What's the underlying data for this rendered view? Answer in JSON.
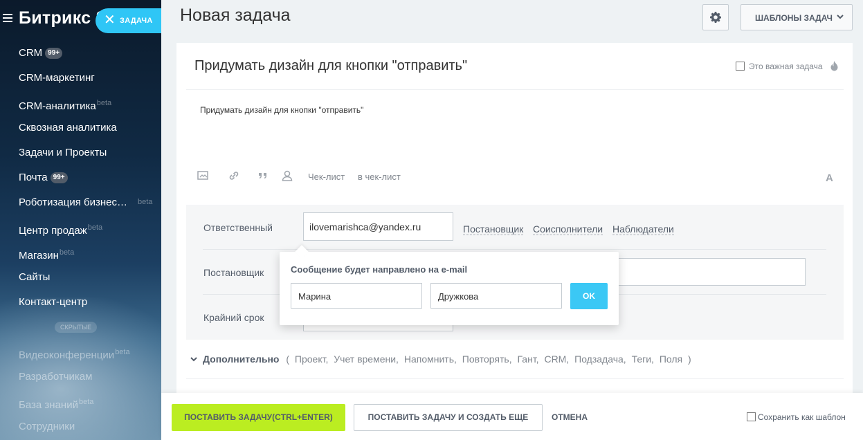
{
  "sidebar": {
    "brand": "Битрикс 24",
    "task_button_label": "ЗАДАЧА",
    "items": [
      {
        "label": "CRM",
        "badge": "99+"
      },
      {
        "label": "CRM-маркетинг"
      },
      {
        "label": "CRM-аналитика",
        "sup": "beta"
      },
      {
        "label": "Сквозная аналитика"
      },
      {
        "label": "Задачи и Проекты"
      },
      {
        "label": "Почта",
        "badge": "99+"
      },
      {
        "label": "Роботизация бизнес…",
        "sup": "beta"
      },
      {
        "label": "Центр продаж",
        "sup": "beta"
      },
      {
        "label": "Магазин",
        "sup": "beta"
      },
      {
        "label": "Сайты"
      },
      {
        "label": "Контакт-центр"
      }
    ],
    "hidden_separator": "СКРЫТЫЕ",
    "hidden_items": [
      {
        "label": "Видеоконференции",
        "sup": "beta"
      },
      {
        "label": "Разработчикам"
      },
      {
        "label": "База знаний",
        "sup": "beta"
      },
      {
        "label": "Сотрудники"
      }
    ]
  },
  "header": {
    "title": "Новая задача",
    "templates_label": "ШАБЛОНЫ ЗАДАЧ"
  },
  "task": {
    "title": "Придумать дизайн для кнопки \"отправить\"",
    "important_label": "Это важная задача",
    "description": "Придумать дизайн для кнопки \"отправить\"",
    "toolbar": {
      "checklist": "Чек-лист",
      "to_checklist": "в чек-лист",
      "font_icon": "A"
    }
  },
  "fields": {
    "responsible_label": "Ответственный",
    "responsible_value": "ilovemarishca@yandex.ru",
    "links": [
      "Постановщик",
      "Соисполнители",
      "Наблюдатели"
    ],
    "setter_label": "Постановщик",
    "deadline_label": "Крайний срок"
  },
  "popup": {
    "message": "Сообщение будет направлено на e-mail",
    "first_name": "Марина",
    "last_name": "Дружкова",
    "ok_label": "OK"
  },
  "extra": {
    "label": "Дополнительно",
    "open_paren": "(",
    "items": [
      "Проект,",
      "Учет времени,",
      "Напомнить,",
      "Повторять,",
      "Гант,",
      "CRM,",
      "Подзадача,",
      "Теги,",
      "Поля"
    ],
    "close_paren": ")"
  },
  "footer": {
    "submit_label": "ПОСТАВИТЬ ЗАДАЧУ(CTRL+ENTER)",
    "submit_more_label": "ПОСТАВИТЬ ЗАДАЧУ И СОЗДАТЬ ЕЩЕ",
    "cancel_label": "ОТМЕНА",
    "save_template_label": "Сохранить как шаблон"
  },
  "colors": {
    "accent": "#2fc6f6",
    "submit": "#bbed21",
    "ok": "#3bc8f5"
  }
}
